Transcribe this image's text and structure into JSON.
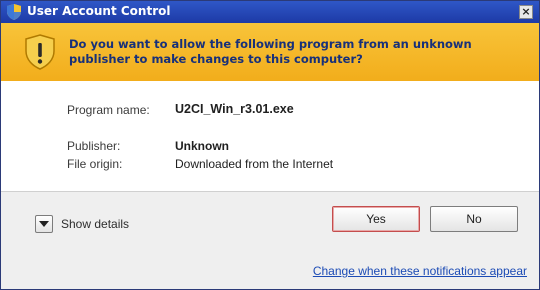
{
  "window": {
    "title": "User Account Control",
    "close_label": "×"
  },
  "banner": {
    "question": "Do you want to allow the following program from an unknown publisher to make changes to this computer?"
  },
  "details": {
    "program_label": "Program name:",
    "program_value": "U2CI_Win_r3.01.exe",
    "publisher_label": "Publisher:",
    "publisher_value": "Unknown",
    "origin_label": "File origin:",
    "origin_value": "Downloaded from the Internet"
  },
  "footer": {
    "show_details_label": "Show details",
    "yes_label": "Yes",
    "no_label": "No",
    "change_link": "Change when these notifications appear"
  },
  "colors": {
    "titlebar": "#1d3aa6",
    "banner": "#f2ad1b",
    "banner_text": "#17307a",
    "link": "#1c4bb5"
  },
  "icons": {
    "title": "uac-shield-icon",
    "banner": "warning-shield-icon",
    "toggle": "chevron-down-icon"
  }
}
